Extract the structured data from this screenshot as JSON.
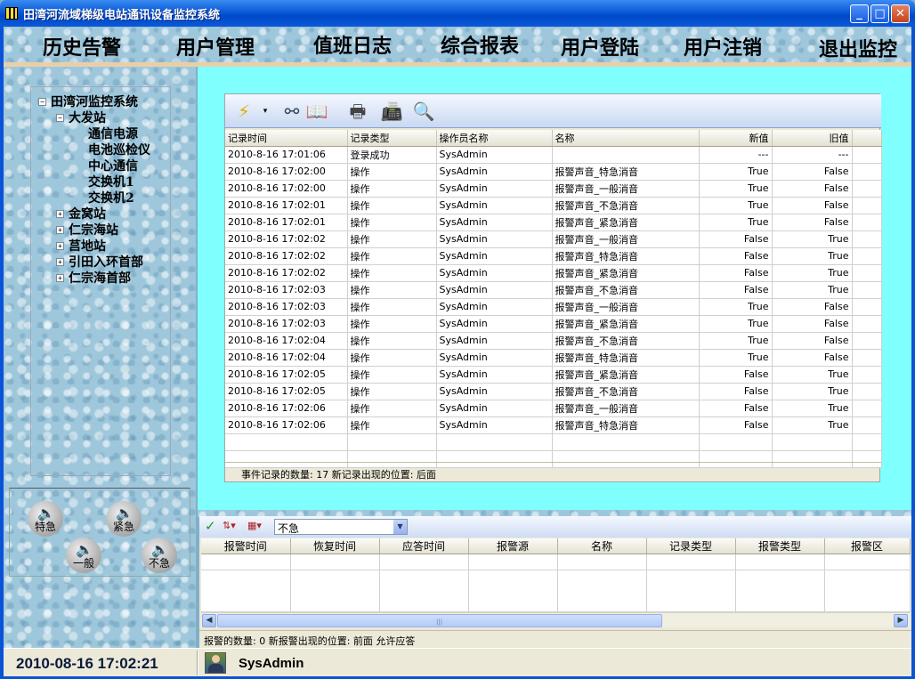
{
  "window": {
    "title": "田湾河流域梯级电站通讯设备监控系统",
    "minimize_label": "_",
    "maximize_label": "□",
    "close_label": "✕"
  },
  "menu": [
    "历史告警",
    "用户管理",
    "值班日志",
    "综合报表",
    "用户登陆",
    "用户注销",
    "退出监控"
  ],
  "tree": {
    "root": "田湾河监控系统",
    "expanded_station": "大发站",
    "devices": [
      "通信电源",
      "电池巡检仪",
      "中心通信",
      "交换机1",
      "交换机2"
    ],
    "stations": [
      "金窝站",
      "仁宗海站",
      "莒地站",
      "引田入环首部",
      "仁宗海首部"
    ],
    "expand_glyph": "+",
    "collapse_glyph": "−"
  },
  "alarm_buttons": [
    "特急",
    "紧急",
    "一般",
    "不急"
  ],
  "alarm_button_icon": "speaker-icon",
  "event_grid": {
    "columns": [
      "记录时间",
      "记录类型",
      "操作员名称",
      "名称",
      "新值",
      "旧值"
    ],
    "rows": [
      [
        "2010-8-16 17:01:06",
        "登录成功",
        "SysAdmin",
        "",
        "---",
        "---"
      ],
      [
        "2010-8-16 17:02:00",
        "操作",
        "SysAdmin",
        "报警声音_特急消音",
        "True",
        "False"
      ],
      [
        "2010-8-16 17:02:00",
        "操作",
        "SysAdmin",
        "报警声音_一般消音",
        "True",
        "False"
      ],
      [
        "2010-8-16 17:02:01",
        "操作",
        "SysAdmin",
        "报警声音_不急消音",
        "True",
        "False"
      ],
      [
        "2010-8-16 17:02:01",
        "操作",
        "SysAdmin",
        "报警声音_紧急消音",
        "True",
        "False"
      ],
      [
        "2010-8-16 17:02:02",
        "操作",
        "SysAdmin",
        "报警声音_一般消音",
        "False",
        "True"
      ],
      [
        "2010-8-16 17:02:02",
        "操作",
        "SysAdmin",
        "报警声音_特急消音",
        "False",
        "True"
      ],
      [
        "2010-8-16 17:02:02",
        "操作",
        "SysAdmin",
        "报警声音_紧急消音",
        "False",
        "True"
      ],
      [
        "2010-8-16 17:02:03",
        "操作",
        "SysAdmin",
        "报警声音_不急消音",
        "False",
        "True"
      ],
      [
        "2010-8-16 17:02:03",
        "操作",
        "SysAdmin",
        "报警声音_一般消音",
        "True",
        "False"
      ],
      [
        "2010-8-16 17:02:03",
        "操作",
        "SysAdmin",
        "报警声音_紧急消音",
        "True",
        "False"
      ],
      [
        "2010-8-16 17:02:04",
        "操作",
        "SysAdmin",
        "报警声音_不急消音",
        "True",
        "False"
      ],
      [
        "2010-8-16 17:02:04",
        "操作",
        "SysAdmin",
        "报警声音_特急消音",
        "True",
        "False"
      ],
      [
        "2010-8-16 17:02:05",
        "操作",
        "SysAdmin",
        "报警声音_紧急消音",
        "False",
        "True"
      ],
      [
        "2010-8-16 17:02:05",
        "操作",
        "SysAdmin",
        "报警声音_不急消音",
        "False",
        "True"
      ],
      [
        "2010-8-16 17:02:06",
        "操作",
        "SysAdmin",
        "报警声音_一般消音",
        "False",
        "True"
      ],
      [
        "2010-8-16 17:02:06",
        "操作",
        "SysAdmin",
        "报警声音_特急消音",
        "False",
        "True"
      ]
    ],
    "status": "事件记录的数量:  17   新记录出现的位置:  后面"
  },
  "toolbar_icons": [
    "lightning-icon",
    "binoculars-icon",
    "book-icon",
    "printer-icon",
    "fax-icon",
    "print-preview-icon"
  ],
  "alarm_filter": {
    "selected": "不急",
    "icons": [
      "check-icon",
      "sort-icon",
      "grid-icon"
    ]
  },
  "alarm_grid": {
    "columns": [
      "报警时间",
      "恢复时间",
      "应答时间",
      "报警源",
      "名称",
      "记录类型",
      "报警类型",
      "报警区"
    ],
    "status": "报警的数量:  0   新报警出现的位置:  前面   允许应答"
  },
  "statusbar": {
    "datetime": "2010-08-16 17:02:21",
    "user": "SysAdmin"
  },
  "colors": {
    "title_blue": "#0a5ad8",
    "cyan_panel": "#80ffff",
    "water_bg": "#9fc7db",
    "speaker_orange": "#e8a000"
  }
}
